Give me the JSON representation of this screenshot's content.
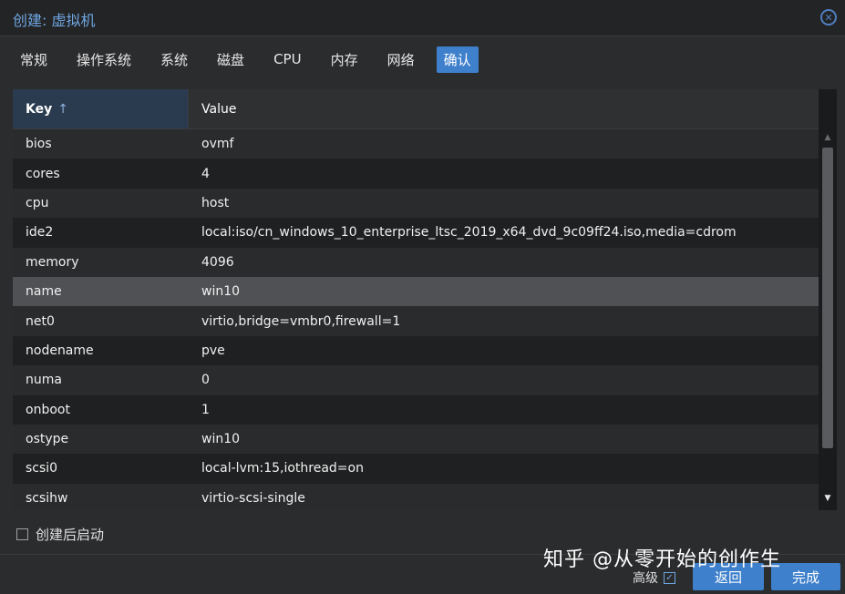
{
  "window": {
    "title": "创建: 虚拟机",
    "close_icon": "close-icon"
  },
  "tabs": [
    {
      "label": "常规"
    },
    {
      "label": "操作系统"
    },
    {
      "label": "系统"
    },
    {
      "label": "磁盘"
    },
    {
      "label": "CPU"
    },
    {
      "label": "内存"
    },
    {
      "label": "网络"
    },
    {
      "label": "确认",
      "active": true
    }
  ],
  "grid": {
    "columns": {
      "key": "Key",
      "sort_arrow": "↑",
      "value": "Value"
    },
    "rows": [
      {
        "key": "bios",
        "value": "ovmf"
      },
      {
        "key": "cores",
        "value": "4"
      },
      {
        "key": "cpu",
        "value": "host"
      },
      {
        "key": "ide2",
        "value": "local:iso/cn_windows_10_enterprise_ltsc_2019_x64_dvd_9c09ff24.iso,media=cdrom"
      },
      {
        "key": "memory",
        "value": "4096"
      },
      {
        "key": "name",
        "value": "win10",
        "selected": true
      },
      {
        "key": "net0",
        "value": "virtio,bridge=vmbr0,firewall=1"
      },
      {
        "key": "nodename",
        "value": "pve"
      },
      {
        "key": "numa",
        "value": "0"
      },
      {
        "key": "onboot",
        "value": "1"
      },
      {
        "key": "ostype",
        "value": "win10"
      },
      {
        "key": "scsi0",
        "value": "local-lvm:15,iothread=on"
      },
      {
        "key": "scsihw",
        "value": "virtio-scsi-single"
      }
    ]
  },
  "footer": {
    "start_after_label": "创建后启动",
    "start_after_checked": false,
    "advanced_label": "高级",
    "advanced_checked": true,
    "advanced_check_glyph": "✓",
    "back_label": "返回",
    "finish_label": "完成"
  },
  "watermark": "知乎 @从零开始的创作生",
  "colors": {
    "accent": "#3f80cc",
    "title": "#6fa6e3",
    "background": "#2b2c2e"
  }
}
